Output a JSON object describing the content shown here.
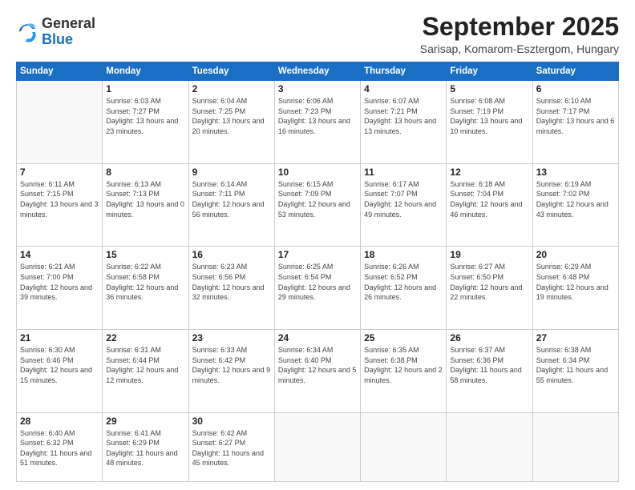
{
  "logo": {
    "general": "General",
    "blue": "Blue"
  },
  "header": {
    "month": "September 2025",
    "location": "Sarisap, Komarom-Esztergom, Hungary"
  },
  "days_of_week": [
    "Sunday",
    "Monday",
    "Tuesday",
    "Wednesday",
    "Thursday",
    "Friday",
    "Saturday"
  ],
  "weeks": [
    [
      {
        "day": "",
        "info": ""
      },
      {
        "day": "1",
        "info": "Sunrise: 6:03 AM\nSunset: 7:27 PM\nDaylight: 13 hours\nand 23 minutes."
      },
      {
        "day": "2",
        "info": "Sunrise: 6:04 AM\nSunset: 7:25 PM\nDaylight: 13 hours\nand 20 minutes."
      },
      {
        "day": "3",
        "info": "Sunrise: 6:06 AM\nSunset: 7:23 PM\nDaylight: 13 hours\nand 16 minutes."
      },
      {
        "day": "4",
        "info": "Sunrise: 6:07 AM\nSunset: 7:21 PM\nDaylight: 13 hours\nand 13 minutes."
      },
      {
        "day": "5",
        "info": "Sunrise: 6:08 AM\nSunset: 7:19 PM\nDaylight: 13 hours\nand 10 minutes."
      },
      {
        "day": "6",
        "info": "Sunrise: 6:10 AM\nSunset: 7:17 PM\nDaylight: 13 hours\nand 6 minutes."
      }
    ],
    [
      {
        "day": "7",
        "info": "Sunrise: 6:11 AM\nSunset: 7:15 PM\nDaylight: 13 hours\nand 3 minutes."
      },
      {
        "day": "8",
        "info": "Sunrise: 6:13 AM\nSunset: 7:13 PM\nDaylight: 13 hours\nand 0 minutes."
      },
      {
        "day": "9",
        "info": "Sunrise: 6:14 AM\nSunset: 7:11 PM\nDaylight: 12 hours\nand 56 minutes."
      },
      {
        "day": "10",
        "info": "Sunrise: 6:15 AM\nSunset: 7:09 PM\nDaylight: 12 hours\nand 53 minutes."
      },
      {
        "day": "11",
        "info": "Sunrise: 6:17 AM\nSunset: 7:07 PM\nDaylight: 12 hours\nand 49 minutes."
      },
      {
        "day": "12",
        "info": "Sunrise: 6:18 AM\nSunset: 7:04 PM\nDaylight: 12 hours\nand 46 minutes."
      },
      {
        "day": "13",
        "info": "Sunrise: 6:19 AM\nSunset: 7:02 PM\nDaylight: 12 hours\nand 43 minutes."
      }
    ],
    [
      {
        "day": "14",
        "info": "Sunrise: 6:21 AM\nSunset: 7:00 PM\nDaylight: 12 hours\nand 39 minutes."
      },
      {
        "day": "15",
        "info": "Sunrise: 6:22 AM\nSunset: 6:58 PM\nDaylight: 12 hours\nand 36 minutes."
      },
      {
        "day": "16",
        "info": "Sunrise: 6:23 AM\nSunset: 6:56 PM\nDaylight: 12 hours\nand 32 minutes."
      },
      {
        "day": "17",
        "info": "Sunrise: 6:25 AM\nSunset: 6:54 PM\nDaylight: 12 hours\nand 29 minutes."
      },
      {
        "day": "18",
        "info": "Sunrise: 6:26 AM\nSunset: 6:52 PM\nDaylight: 12 hours\nand 26 minutes."
      },
      {
        "day": "19",
        "info": "Sunrise: 6:27 AM\nSunset: 6:50 PM\nDaylight: 12 hours\nand 22 minutes."
      },
      {
        "day": "20",
        "info": "Sunrise: 6:29 AM\nSunset: 6:48 PM\nDaylight: 12 hours\nand 19 minutes."
      }
    ],
    [
      {
        "day": "21",
        "info": "Sunrise: 6:30 AM\nSunset: 6:46 PM\nDaylight: 12 hours\nand 15 minutes."
      },
      {
        "day": "22",
        "info": "Sunrise: 6:31 AM\nSunset: 6:44 PM\nDaylight: 12 hours\nand 12 minutes."
      },
      {
        "day": "23",
        "info": "Sunrise: 6:33 AM\nSunset: 6:42 PM\nDaylight: 12 hours\nand 9 minutes."
      },
      {
        "day": "24",
        "info": "Sunrise: 6:34 AM\nSunset: 6:40 PM\nDaylight: 12 hours\nand 5 minutes."
      },
      {
        "day": "25",
        "info": "Sunrise: 6:35 AM\nSunset: 6:38 PM\nDaylight: 12 hours\nand 2 minutes."
      },
      {
        "day": "26",
        "info": "Sunrise: 6:37 AM\nSunset: 6:36 PM\nDaylight: 11 hours\nand 58 minutes."
      },
      {
        "day": "27",
        "info": "Sunrise: 6:38 AM\nSunset: 6:34 PM\nDaylight: 11 hours\nand 55 minutes."
      }
    ],
    [
      {
        "day": "28",
        "info": "Sunrise: 6:40 AM\nSunset: 6:32 PM\nDaylight: 11 hours\nand 51 minutes."
      },
      {
        "day": "29",
        "info": "Sunrise: 6:41 AM\nSunset: 6:29 PM\nDaylight: 11 hours\nand 48 minutes."
      },
      {
        "day": "30",
        "info": "Sunrise: 6:42 AM\nSunset: 6:27 PM\nDaylight: 11 hours\nand 45 minutes."
      },
      {
        "day": "",
        "info": ""
      },
      {
        "day": "",
        "info": ""
      },
      {
        "day": "",
        "info": ""
      },
      {
        "day": "",
        "info": ""
      }
    ]
  ]
}
